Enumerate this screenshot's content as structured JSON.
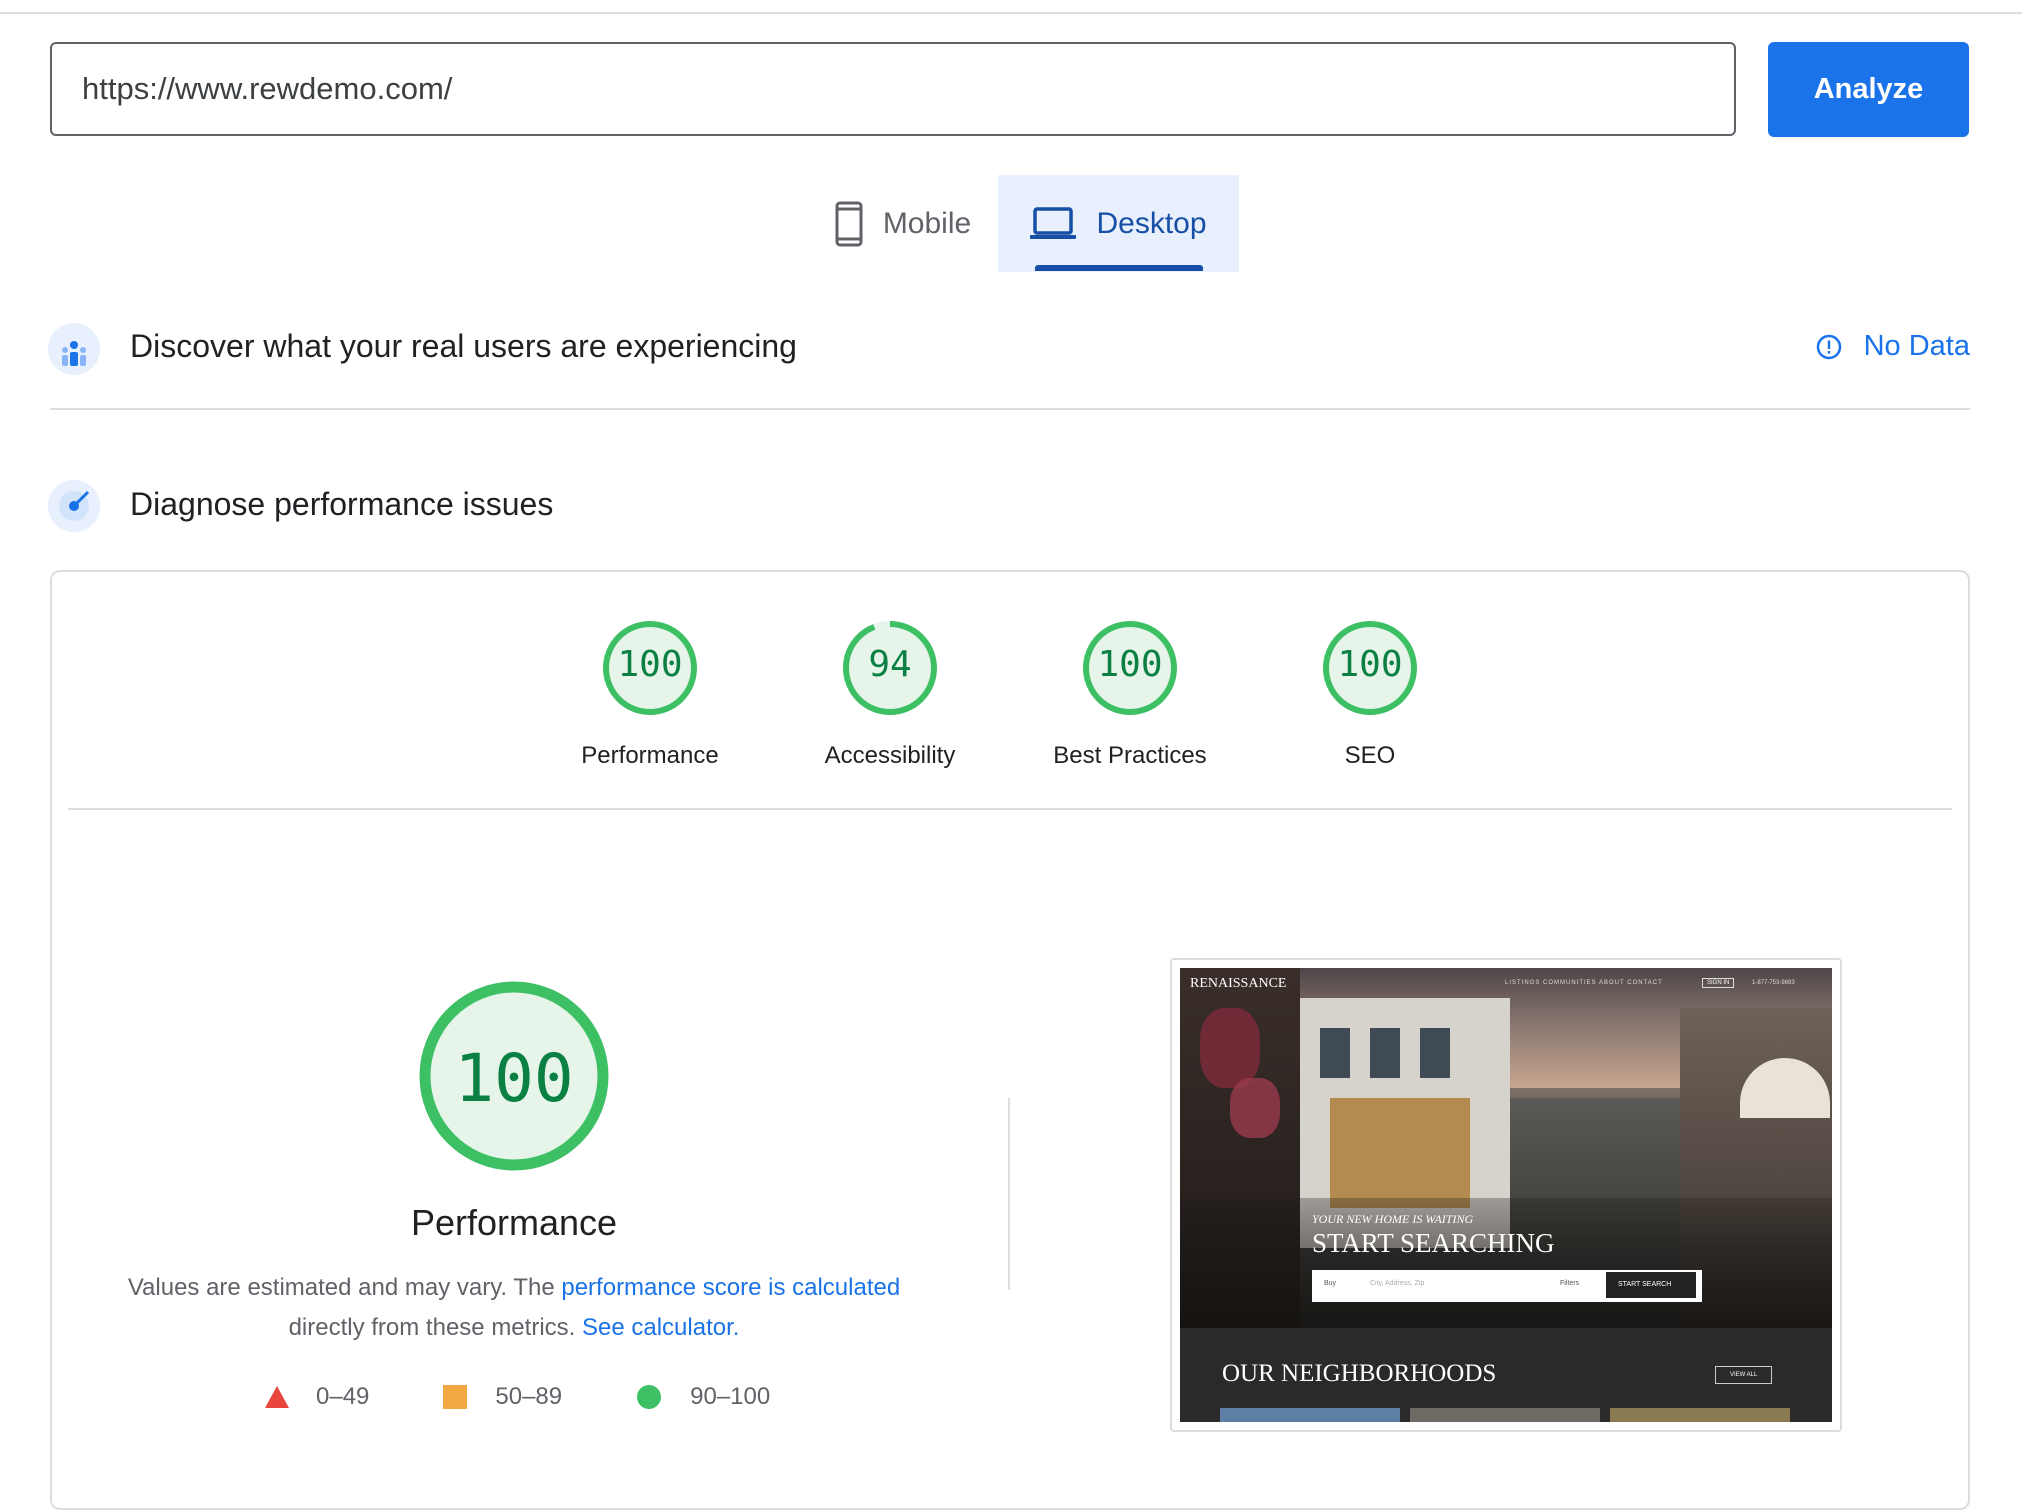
{
  "url_input": {
    "value": "https://www.rewdemo.com/"
  },
  "analyze_button": "Analyze",
  "device_tabs": [
    {
      "label": "Mobile",
      "selected": false,
      "icon": "phone-icon"
    },
    {
      "label": "Desktop",
      "selected": true,
      "icon": "laptop-icon"
    }
  ],
  "crux_section": {
    "title": "Discover what your real users are experiencing",
    "status": "No Data",
    "status_icon": "info-icon"
  },
  "diagnose_section": {
    "title": "Diagnose performance issues"
  },
  "scores": [
    {
      "label": "Performance",
      "value": "100"
    },
    {
      "label": "Accessibility",
      "value": "94"
    },
    {
      "label": "Best Practices",
      "value": "100"
    },
    {
      "label": "SEO",
      "value": "100"
    }
  ],
  "performance_detail": {
    "score": "100",
    "title": "Performance",
    "desc_prefix": "Values are estimated and may vary. The ",
    "desc_link": "performance score is calculated",
    "desc_middle": "directly from these metrics. ",
    "desc_link2": "See calculator."
  },
  "legend": [
    {
      "range": "0–49",
      "shape": "triangle",
      "color": "#e8453c"
    },
    {
      "range": "50–89",
      "shape": "square",
      "color": "#f4a844"
    },
    {
      "range": "90–100",
      "shape": "circle",
      "color": "#3dc064"
    }
  ],
  "screenshot": {
    "brand": "RENAISSANCE",
    "nav": "LISTINGS  COMMUNITIES  ABOUT  CONTACT",
    "signin": "SIGN IN",
    "phone": "1-877-753-9893",
    "tagline": "YOUR NEW HOME IS WAITING",
    "headline": "START SEARCHING",
    "search_select": "Buy",
    "search_placeholder": "City, Address, Zip",
    "filters": "Filters",
    "search_button": "START SEARCH",
    "section": "OUR NEIGHBORHOODS",
    "view_all": "VIEW ALL"
  },
  "colors": {
    "accent": "#1a73e8",
    "pass_green": "#0cce6b",
    "pass_text": "#0b8043",
    "pass_bg": "#e6f4ea"
  }
}
